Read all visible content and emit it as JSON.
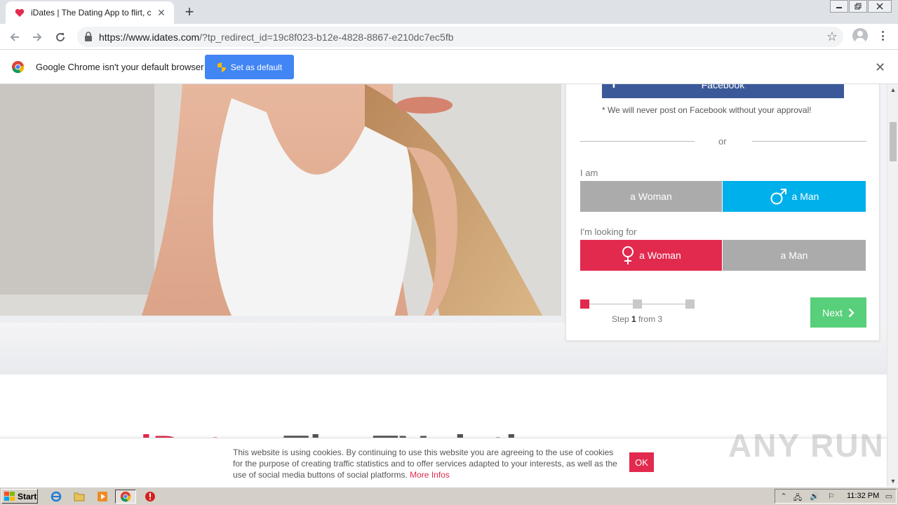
{
  "browser": {
    "tab_title": "iDates | The Dating App to flirt, chat",
    "url_host": "https://www.idates.com",
    "url_path": "/?tp_redirect_id=19c8f023-b12e-4828-8867-e210dc7ec5fb"
  },
  "infobar": {
    "message": "Google Chrome isn't your default browser",
    "set_default_label": "Set as default"
  },
  "signup": {
    "facebook_label": "Facebook",
    "facebook_note": "* We will never post on Facebook without your approval!",
    "or_label": "or",
    "i_am_label": "I am",
    "i_am_options": [
      "a Woman",
      "a Man"
    ],
    "looking_for_label": "I'm looking for",
    "looking_for_options": [
      "a Woman",
      "a Man"
    ],
    "step_prefix": "Step",
    "step_current": "1",
    "step_suffix": "from 3",
    "next_label": "Next",
    "colors": {
      "accent_red": "#e22a4e",
      "accent_blue": "#00b0eb",
      "next_green": "#58cf7a",
      "facebook_blue": "#3b5998"
    }
  },
  "page": {
    "heading_brand": "iDates",
    "heading_rest": "The TV dating app"
  },
  "cookie": {
    "text": "This website is using cookies. By continuing to use this website you are agreeing to the use of cookies for the purpose of creating traffic statistics and to offer services adapted to your interests, as well as the use of social media buttons of social platforms.",
    "link_label": "More Infos",
    "ok_label": "OK"
  },
  "watermark": "ANY RUN",
  "taskbar": {
    "start_label": "Start",
    "clock": "11:32 PM"
  }
}
